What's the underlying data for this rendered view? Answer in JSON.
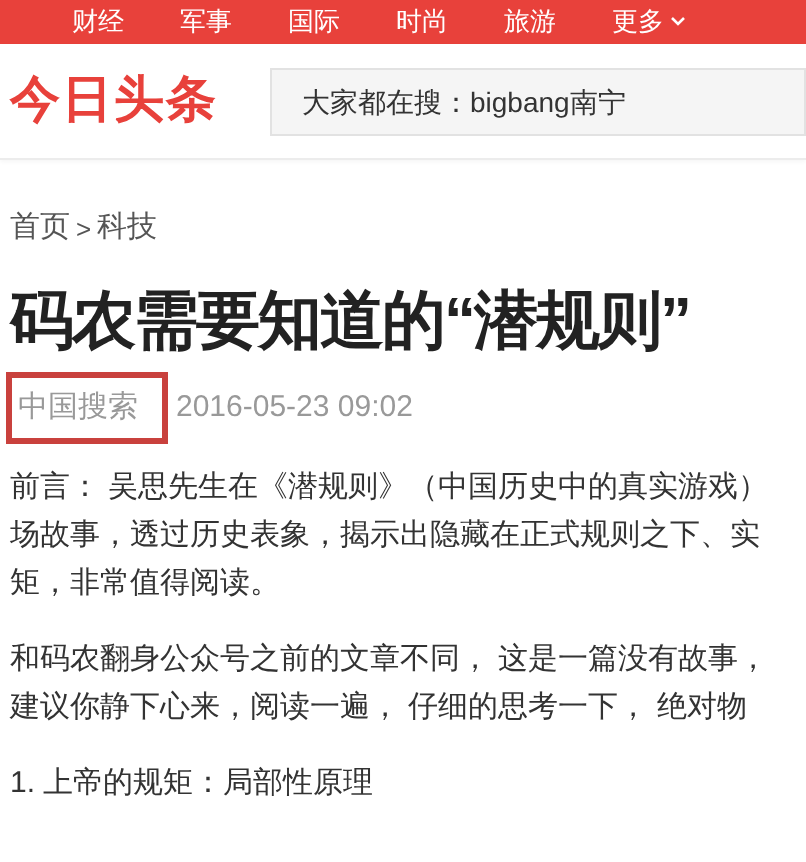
{
  "nav": {
    "items": [
      "财经",
      "军事",
      "国际",
      "时尚",
      "旅游"
    ],
    "more": "更多"
  },
  "header": {
    "logo": "今日头条",
    "search": {
      "placeholder": "大家都在搜：bigbang南宁"
    }
  },
  "breadcrumb": {
    "home": "首页",
    "separator": ">",
    "current": "科技"
  },
  "article": {
    "title": "码农需要知道的“潜规则”",
    "source": "中国搜索",
    "source_highlighted": true,
    "time": "2016-05-23 09:02",
    "paragraphs": [
      [
        "前言： 吴思先生在《潜规则》（中国历史中的真实游戏）",
        "场故事，透过历史表象，揭示出隐藏在正式规则之下、实",
        "矩，非常值得阅读。"
      ],
      [
        "和码农翻身公众号之前的文章不同， 这是一篇没有故事，",
        "建议你静下心来，阅读一遍， 仔细的思考一下， 绝对物"
      ],
      [
        "1. 上帝的规矩：局部性原理"
      ]
    ]
  }
}
